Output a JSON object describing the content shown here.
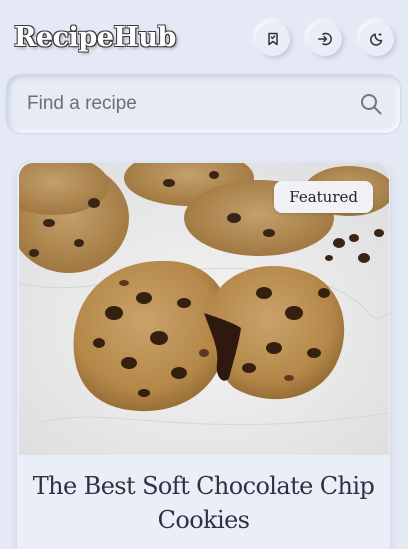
{
  "header": {
    "brand": "RecipeHub",
    "buttons": [
      {
        "name": "bookmark-button",
        "icon": "bookmark-icon"
      },
      {
        "name": "login-button",
        "icon": "login-icon"
      },
      {
        "name": "theme-toggle-button",
        "icon": "moon-icon"
      }
    ]
  },
  "search": {
    "placeholder": "Find a recipe",
    "icon": "search-icon"
  },
  "card": {
    "badge": "Featured",
    "title": "The Best Soft Chocolate Chip Cookies",
    "image_alt": "chocolate chip cookies on marble"
  },
  "colors": {
    "background": "#e4e9f5",
    "title": "#2f3340"
  }
}
